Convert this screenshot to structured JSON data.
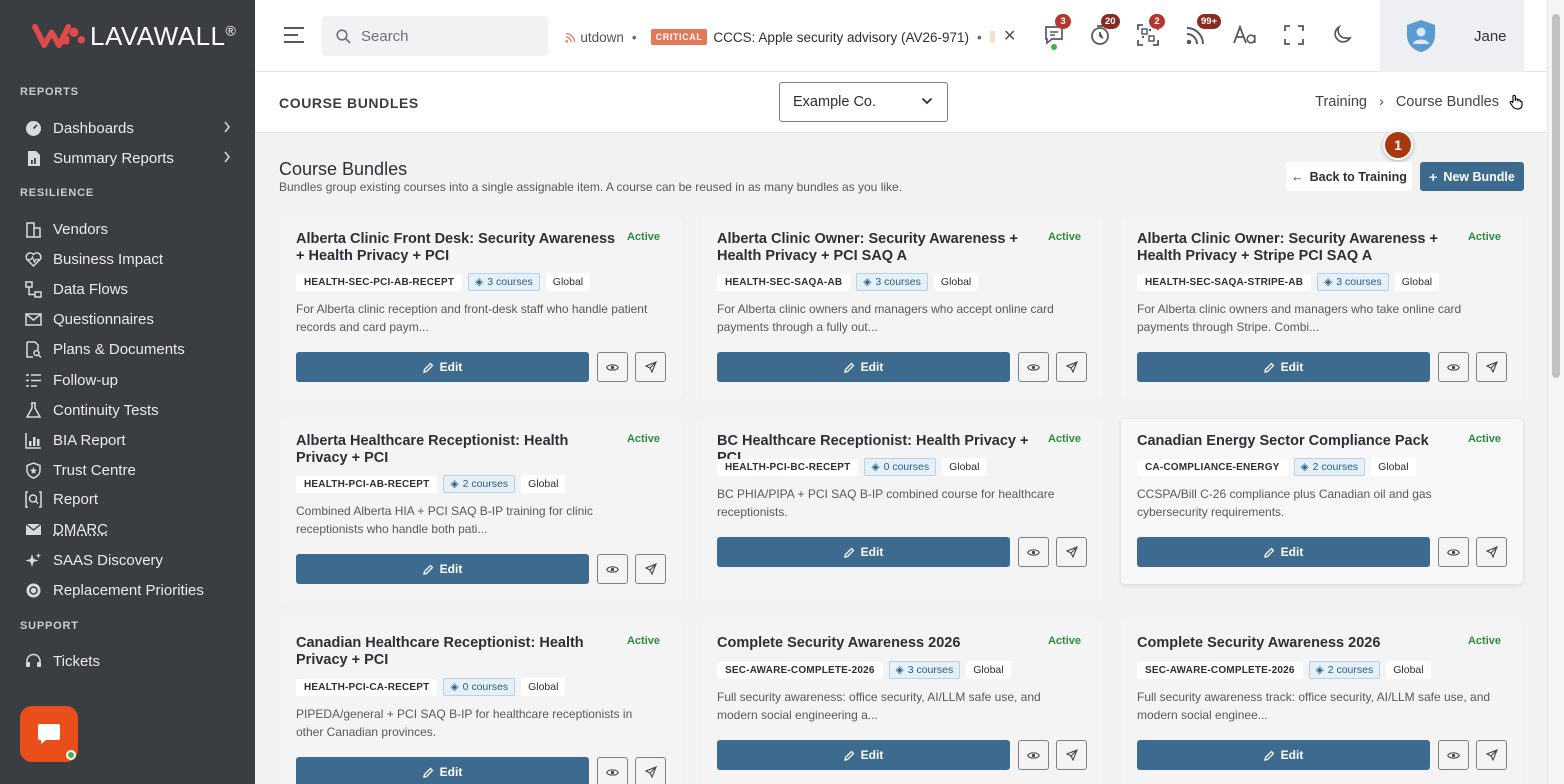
{
  "app": {
    "logo_text": "LAVAWALL",
    "logo_mark": "®",
    "brand_color": "#e94e1b"
  },
  "sidebar": {
    "sections": [
      "REPORTS",
      "RESILIENCE",
      "SUPPORT"
    ],
    "items": [
      {
        "label": "Dashboards",
        "icon": "gauge-icon",
        "has_submenu": true
      },
      {
        "label": "Summary Reports",
        "icon": "report-chart-icon",
        "has_submenu": true
      },
      {
        "label": "Vendors",
        "icon": "building-icon"
      },
      {
        "label": "Business Impact",
        "icon": "heart-pulse-icon"
      },
      {
        "label": "Data Flows",
        "icon": "flow-icon"
      },
      {
        "label": "Questionnaires",
        "icon": "envelope-icon"
      },
      {
        "label": "Plans & Documents",
        "icon": "document-search-icon"
      },
      {
        "label": "Follow-up",
        "icon": "list-check-icon"
      },
      {
        "label": "Continuity Tests",
        "icon": "flask-icon"
      },
      {
        "label": "BIA Report",
        "icon": "bar-chart-icon"
      },
      {
        "label": "Trust Centre",
        "icon": "shield-icon"
      },
      {
        "label": "Report",
        "icon": "search-report-icon"
      },
      {
        "label": "DMARC",
        "icon": "mail-check-icon"
      },
      {
        "label": "SAAS Discovery",
        "icon": "sparkle-icon"
      },
      {
        "label": "Replacement Priorities",
        "icon": "cycle-icon"
      },
      {
        "label": "Tickets",
        "icon": "headset-icon"
      }
    ]
  },
  "topbar": {
    "search_placeholder": "Search",
    "ticker_prefix": "utdown",
    "ticker_badge": "CRITICAL",
    "ticker_text": "CCCS: Apple security advisory (AV26-971)",
    "badges": {
      "messages": "3",
      "timer": "20",
      "qr": "2",
      "feeds": "99+"
    },
    "user_name": "Jane"
  },
  "page_header": {
    "title": "COURSE BUNDLES",
    "company": "Example Co.",
    "breadcrumb": [
      "Training",
      "Course Bundles"
    ]
  },
  "content": {
    "title": "Course Bundles",
    "subtitle": "Bundles group existing courses into a single assignable item. A course can be reused in as many bundles as you like.",
    "back_label": "Back to Training",
    "new_label": "New Bundle",
    "step_marker": "1",
    "edit_label": "Edit",
    "cards": [
      {
        "title": "Alberta Clinic Front Desk: Security Awareness + Health Privacy + PCI",
        "status": "Active",
        "code": "HEALTH-SEC-PCI-AB-RECEPT",
        "courses": "3 courses",
        "scope": "Global",
        "description": "For Alberta clinic reception and front-desk staff who handle patient records and card paym..."
      },
      {
        "title": "Alberta Clinic Owner: Security Awareness + Health Privacy + PCI SAQ A",
        "status": "Active",
        "code": "HEALTH-SEC-SAQA-AB",
        "courses": "3 courses",
        "scope": "Global",
        "description": "For Alberta clinic owners and managers who accept online card payments through a fully out..."
      },
      {
        "title": "Alberta Clinic Owner: Security Awareness + Health Privacy + Stripe PCI SAQ A",
        "status": "Active",
        "code": "HEALTH-SEC-SAQA-STRIPE-AB",
        "courses": "3 courses",
        "scope": "Global",
        "description": "For Alberta clinic owners and managers who take online card payments through Stripe. Combi..."
      },
      {
        "title": "Alberta Healthcare Receptionist: Health Privacy + PCI",
        "status": "Active",
        "code": "HEALTH-PCI-AB-RECEPT",
        "courses": "2 courses",
        "scope": "Global",
        "description": "Combined Alberta HIA + PCI SAQ B-IP training for clinic receptionists who handle both pati..."
      },
      {
        "title": "BC Healthcare Receptionist: Health Privacy + PCI",
        "status": "Active",
        "code": "HEALTH-PCI-BC-RECEPT",
        "courses": "0 courses",
        "scope": "Global",
        "description": "BC PHIA/PIPA + PCI SAQ B-IP combined course for healthcare receptionists."
      },
      {
        "title": "Canadian Energy Sector Compliance Pack",
        "status": "Active",
        "code": "CA-COMPLIANCE-ENERGY",
        "courses": "2 courses",
        "scope": "Global",
        "description": "CCSPA/Bill C-26 compliance plus Canadian oil and gas cybersecurity requirements."
      },
      {
        "title": "Canadian Healthcare Receptionist: Health Privacy + PCI",
        "status": "Active",
        "code": "HEALTH-PCI-CA-RECEPT",
        "courses": "0 courses",
        "scope": "Global",
        "description": "PIPEDA/general + PCI SAQ B-IP for healthcare receptionists in other Canadian provinces."
      },
      {
        "title": "Complete Security Awareness 2026",
        "status": "Active",
        "code": "SEC-AWARE-COMPLETE-2026",
        "courses": "3 courses",
        "scope": "Global",
        "description": "Full security awareness: office security, AI/LLM safe use, and modern social engineering a..."
      },
      {
        "title": "Complete Security Awareness 2026",
        "status": "Active",
        "code": "SEC-AWARE-COMPLETE-2026",
        "courses": "2 courses",
        "scope": "Global",
        "description": "Full security awareness track: office security, AI/LLM safe use, and modern social enginee..."
      }
    ]
  }
}
